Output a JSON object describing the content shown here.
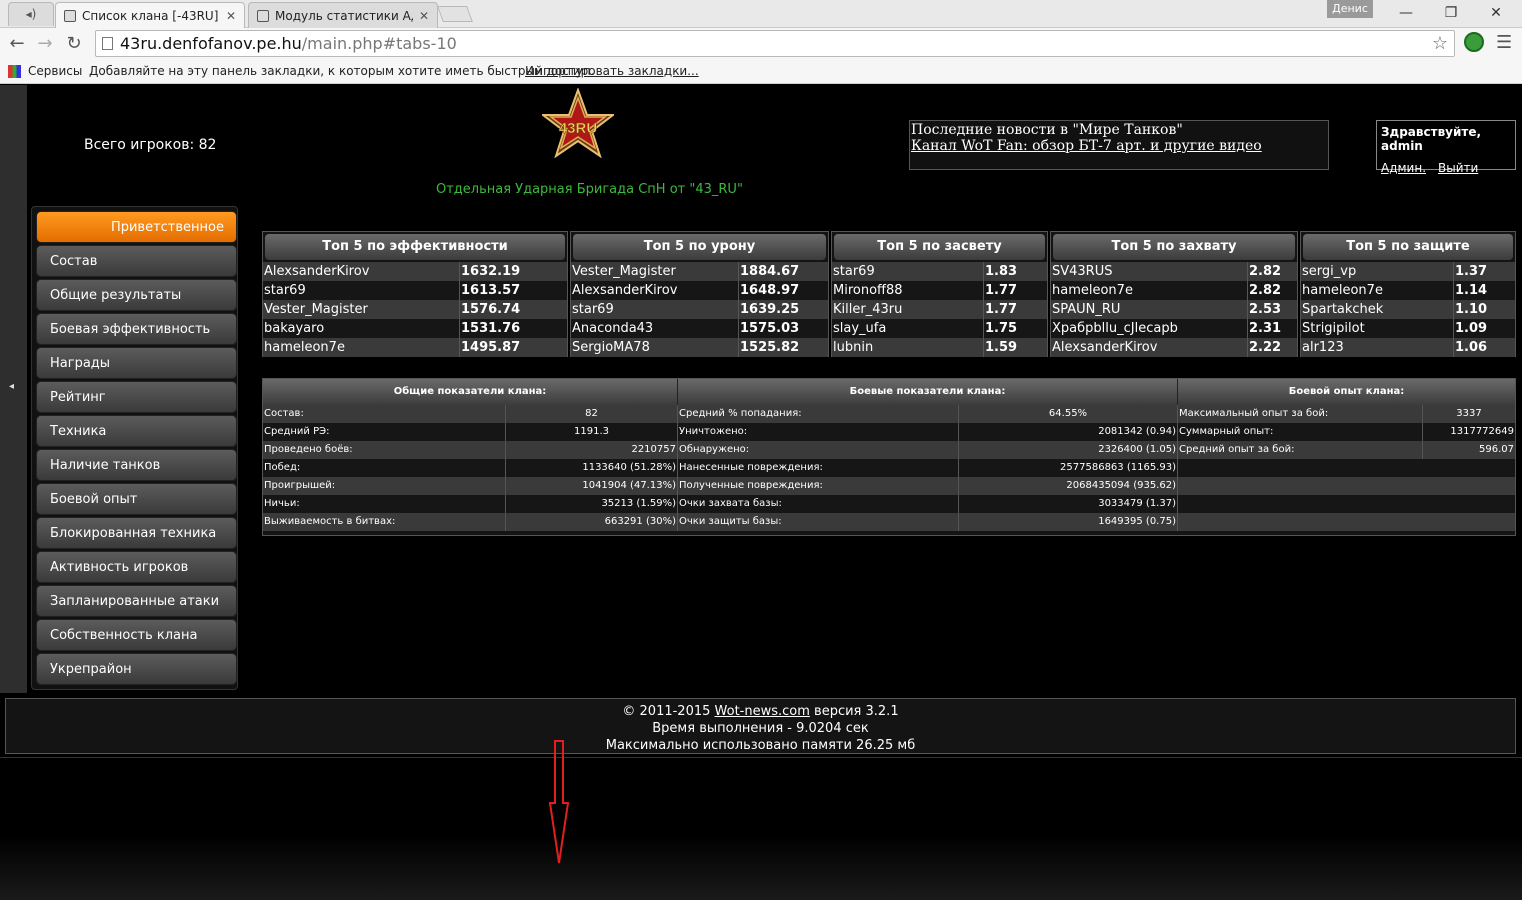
{
  "browser": {
    "tabs": [
      {
        "title": "Список клана [-43RU]",
        "active": true
      },
      {
        "title": "Модуль статистики Адми",
        "active": false
      }
    ],
    "user": "Денис",
    "window_controls": {
      "minimize": "—",
      "maximize": "❐",
      "close": "✕"
    },
    "url_host": "43ru.denfofanov.pe.hu",
    "url_path": "/main.php#tabs-10",
    "bookmarks": {
      "services": "Сервисы",
      "hint": "Добавляйте на эту панель закладки, к которым хотите иметь быстрый доступ.",
      "import": "Импортировать закладки..."
    }
  },
  "header": {
    "total_players": "Всего игроков: 82",
    "logo_text": "43RU",
    "brigade": "Отдельная Ударная Бригада СпН от \"43_RU\"",
    "news_title": "Последние новости в \"Мире Танков\"",
    "news_link": "Канал WoT Fan: обзор БТ-7 арт. и другие видео",
    "greeting": "Здравствуйте, admin",
    "admin_link": "Админ.",
    "logout_link": "Выйти"
  },
  "sidebar": {
    "collapse_glyph": "◂",
    "items": [
      {
        "label": "Приветственное",
        "active": true
      },
      {
        "label": "Состав"
      },
      {
        "label": "Общие результаты"
      },
      {
        "label": "Боевая эффективность"
      },
      {
        "label": "Награды"
      },
      {
        "label": "Рейтинг"
      },
      {
        "label": "Техника"
      },
      {
        "label": "Наличие танков"
      },
      {
        "label": "Боевой опыт"
      },
      {
        "label": "Блокированная техника"
      },
      {
        "label": "Активность игроков"
      },
      {
        "label": "Запланированные атаки"
      },
      {
        "label": "Собственность клана"
      },
      {
        "label": "Укрепрайон"
      }
    ]
  },
  "top5": [
    {
      "title": "Топ 5 по эффективности",
      "rows": [
        [
          "AlexsanderKirov",
          "1632.19"
        ],
        [
          "star69",
          "1613.57"
        ],
        [
          "Vester_Magister",
          "1576.74"
        ],
        [
          "bakayaro",
          "1531.76"
        ],
        [
          "hameleon7e",
          "1495.87"
        ]
      ]
    },
    {
      "title": "Топ 5 по урону",
      "rows": [
        [
          "Vester_Magister",
          "1884.67"
        ],
        [
          "AlexsanderKirov",
          "1648.97"
        ],
        [
          "star69",
          "1639.25"
        ],
        [
          "Anaconda43",
          "1575.03"
        ],
        [
          "SergioMA78",
          "1525.82"
        ]
      ]
    },
    {
      "title": "Топ 5 по засвету",
      "rows": [
        [
          "star69",
          "1.83"
        ],
        [
          "Mironoff88",
          "1.77"
        ],
        [
          "Killer_43ru",
          "1.77"
        ],
        [
          "slay_ufa",
          "1.75"
        ],
        [
          "lubnin",
          "1.59"
        ]
      ]
    },
    {
      "title": "Топ 5 по захвату",
      "rows": [
        [
          "SV43RUS",
          "2.82"
        ],
        [
          "hameleon7e",
          "2.82"
        ],
        [
          "SPAUN_RU",
          "2.53"
        ],
        [
          "Храбpbllu_cJlecapb",
          "2.31"
        ],
        [
          "AlexsanderKirov",
          "2.22"
        ]
      ]
    },
    {
      "title": "Топ 5 по защите",
      "rows": [
        [
          "sergi_vp",
          "1.37"
        ],
        [
          "hameleon7e",
          "1.14"
        ],
        [
          "Spartakchek",
          "1.10"
        ],
        [
          "Strigipilot",
          "1.09"
        ],
        [
          "alr123",
          "1.06"
        ]
      ]
    }
  ],
  "stats": {
    "headers": [
      "Общие показатели клана:",
      "Боевые показатели клана:",
      "Боевой опыт клана:"
    ],
    "general": [
      [
        "Состав:",
        "82"
      ],
      [
        "Средний РЭ:",
        "1191.3"
      ],
      [
        "Проведено боёв:",
        "2210757"
      ],
      [
        "Побед:",
        "1133640 (51.28%)"
      ],
      [
        "Проигрышей:",
        "1041904 (47.13%)"
      ],
      [
        "Ничьи:",
        "35213 (1.59%)"
      ],
      [
        "Выживаемость в битвах:",
        "663291 (30%)"
      ]
    ],
    "battle": [
      [
        "Средний % попадания:",
        "64.55%"
      ],
      [
        "Уничтожено:",
        "2081342 (0.94)"
      ],
      [
        "Обнаружено:",
        "2326400 (1.05)"
      ],
      [
        "Нанесенные повреждения:",
        "2577586863 (1165.93)"
      ],
      [
        "Полученные повреждения:",
        "2068435094 (935.62)"
      ],
      [
        "Очки захвата базы:",
        "3033479 (1.37)"
      ],
      [
        "Очки защиты базы:",
        "1649395 (0.75)"
      ]
    ],
    "experience": [
      [
        "Максимальный опыт за бой:",
        "3337"
      ],
      [
        "Суммарный опыт:",
        "1317772649"
      ],
      [
        "Средний опыт за бой:",
        "596.07"
      ]
    ]
  },
  "footer": {
    "copy": "© 2011-2015",
    "site": "Wot-news.com",
    "version": "версия 3.2.1",
    "time": "Время выполнения - 9.0204 сек",
    "memory": "Максимально использовано памяти 26.25 мб"
  },
  "colors": {
    "accent": "#f07d00",
    "brigade_text": "#3cba3c",
    "annotation_arrow": "#e02020"
  }
}
